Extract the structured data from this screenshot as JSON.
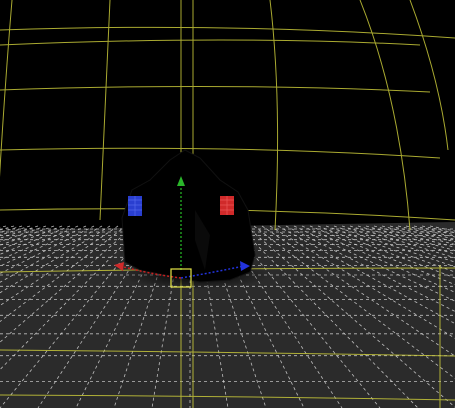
{
  "viewport": {
    "background": "#000000",
    "floor_color": "#2b2b2b",
    "floor_grid_color": "#d0d0d0",
    "guide_grid_color": "#c8c83a",
    "object_color": "#000000",
    "gizmo": {
      "x_axis_color": "#cc1f1f",
      "y_axis_color": "#1f9a1f",
      "z_axis_color": "#2233dd",
      "pivot_color": "#e6e646"
    },
    "markers": [
      {
        "name": "blue-marker",
        "color": "#2a3fd0"
      },
      {
        "name": "red-marker",
        "color": "#d02a2a"
      }
    ],
    "icons": [
      "move-gizmo-icon",
      "pivot-handle-icon"
    ]
  }
}
